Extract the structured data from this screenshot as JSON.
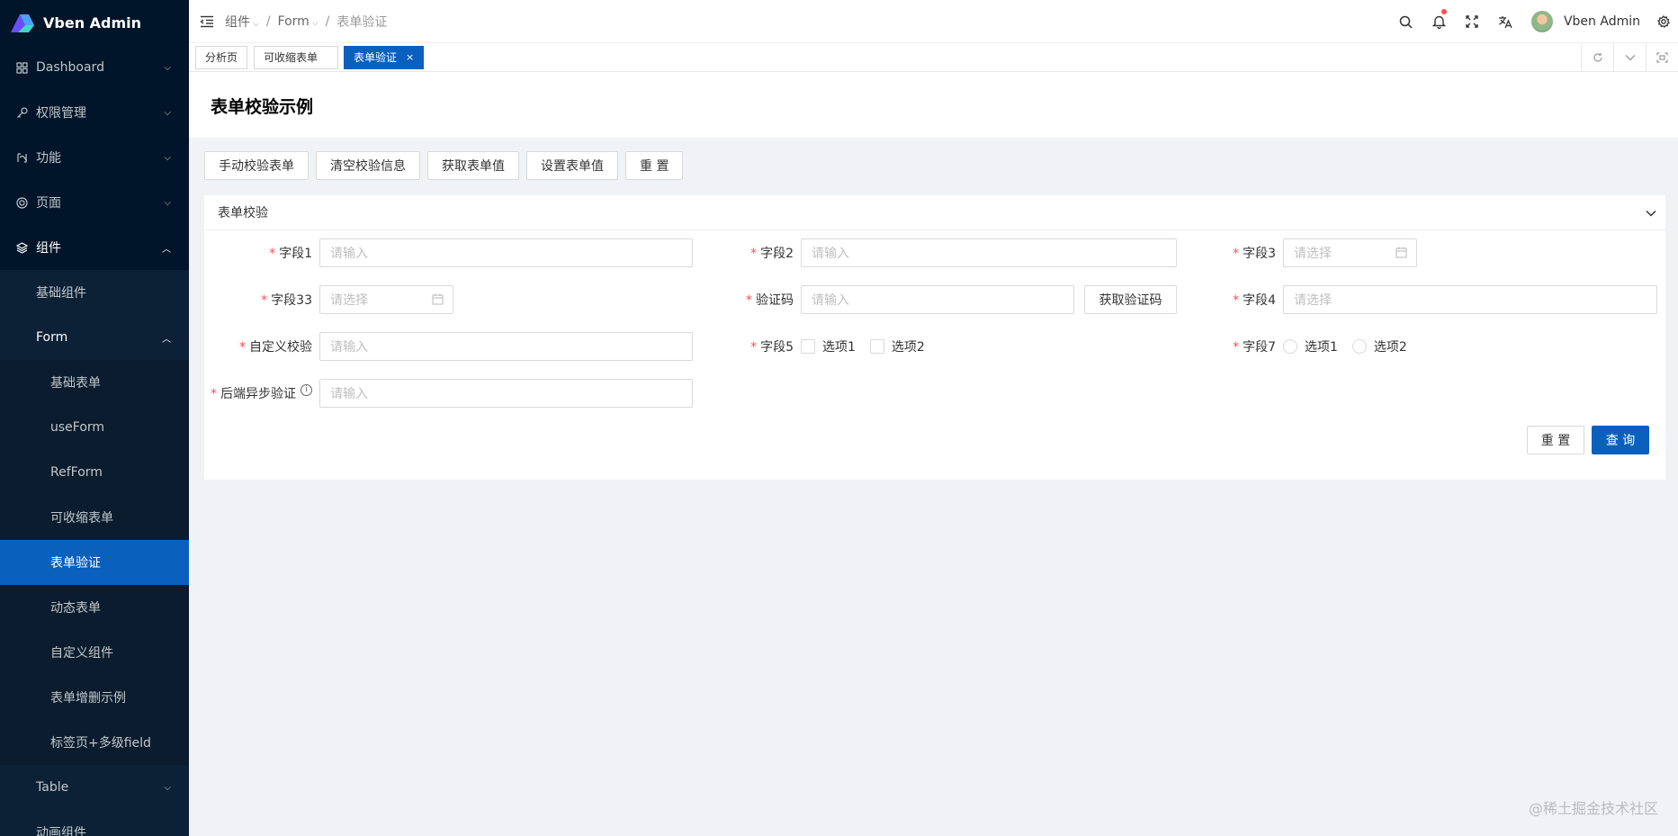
{
  "app": {
    "name": "Vben Admin"
  },
  "sidebar": {
    "items": [
      {
        "label": "Dashboard",
        "icon": "dashboard-icon"
      },
      {
        "label": "权限管理",
        "icon": "key-icon"
      },
      {
        "label": "功能",
        "icon": "function-icon"
      },
      {
        "label": "页面",
        "icon": "page-icon"
      },
      {
        "label": "组件",
        "icon": "layers-icon"
      }
    ],
    "components_sub": {
      "basic": "基础组件",
      "form": "Form",
      "form_children": [
        "基础表单",
        "useForm",
        "RefForm",
        "可收缩表单",
        "表单验证",
        "动态表单",
        "自定义组件",
        "表单增删示例",
        "标签页+多级field"
      ],
      "table": "Table",
      "animation": "动画组件"
    }
  },
  "header": {
    "breadcrumb": [
      "组件",
      "Form",
      "表单验证"
    ],
    "user_name": "Vben Admin"
  },
  "tabs": [
    {
      "label": "分析页"
    },
    {
      "label": "可收缩表单"
    },
    {
      "label": "表单验证",
      "close": "×"
    }
  ],
  "page": {
    "title": "表单校验示例"
  },
  "toolbar": [
    "手动校验表单",
    "清空校验信息",
    "获取表单值",
    "设置表单值",
    "重 置"
  ],
  "card": {
    "title": "表单校验"
  },
  "form": {
    "field1": {
      "label": "字段1",
      "placeholder": "请输入"
    },
    "field2": {
      "label": "字段2",
      "placeholder": "请输入"
    },
    "field3": {
      "label": "字段3",
      "placeholder": "请选择"
    },
    "field33": {
      "label": "字段33",
      "placeholder": "请选择"
    },
    "captcha": {
      "label": "验证码",
      "placeholder": "请输入",
      "button": "获取验证码"
    },
    "field4": {
      "label": "字段4",
      "placeholder": "请选择"
    },
    "custom": {
      "label": "自定义校验",
      "placeholder": "请输入"
    },
    "field5": {
      "label": "字段5",
      "options": [
        "选项1",
        "选项2"
      ]
    },
    "field7": {
      "label": "字段7",
      "options": [
        "选项1",
        "选项2"
      ]
    },
    "async": {
      "label": "后端异步验证",
      "placeholder": "请输入"
    },
    "reset": "重 置",
    "submit": "查 询"
  },
  "required_mark": "*",
  "watermark": "@稀土掘金技术社区",
  "colors": {
    "primary": "#0960bd",
    "sidebar": "#001529",
    "required": "#ff4d4f"
  }
}
